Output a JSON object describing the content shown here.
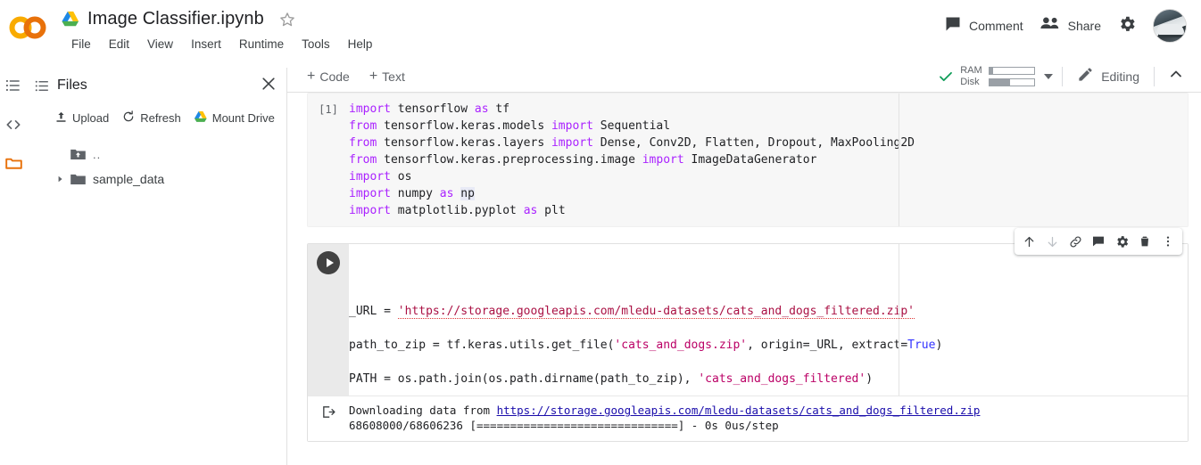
{
  "app": {
    "logo_text": "CO",
    "brand_colors": {
      "logo_outer": "#F9AB00",
      "logo_inner": "#E8710A",
      "accent_folder": "#E8710A"
    }
  },
  "header": {
    "drive_icon": "drive-icon",
    "title": "Image Classifier.ipynb",
    "star_icon": "star-outline-icon",
    "menus": [
      "File",
      "Edit",
      "View",
      "Insert",
      "Runtime",
      "Tools",
      "Help"
    ],
    "comment": {
      "label": "Comment",
      "icon": "comment-icon"
    },
    "share": {
      "label": "Share",
      "icon": "people-icon"
    },
    "settings_icon": "gear-icon",
    "avatar": "user-avatar"
  },
  "toolbar": {
    "add_code_label": "Code",
    "add_text_label": "Text",
    "plus": "+",
    "connected_icon": "green-check-icon",
    "resources": {
      "ram_label": "RAM",
      "disk_label": "Disk",
      "ram_fill_pct": 8,
      "disk_fill_pct": 46
    },
    "dropdown_icon": "chevron-down-icon",
    "editing_label": "Editing",
    "editing_icon": "pencil-icon",
    "collapse_icon": "chevron-up-icon"
  },
  "rail": {
    "items": [
      {
        "name": "table-of-contents",
        "icon": "list-icon"
      },
      {
        "name": "code-snippets",
        "icon": "code-brackets-icon"
      },
      {
        "name": "files",
        "icon": "folder-icon",
        "active": true
      }
    ]
  },
  "files_panel": {
    "menu_icon": "list-icon",
    "title": "Files",
    "close_icon": "close-icon",
    "actions": [
      {
        "label": "Upload",
        "icon": "upload-icon"
      },
      {
        "label": "Refresh",
        "icon": "refresh-icon"
      },
      {
        "label": "Mount Drive",
        "icon": "drive-icon"
      }
    ],
    "tree": [
      {
        "label": "..",
        "icon": "folder-up-icon",
        "expandable": false
      },
      {
        "label": "sample_data",
        "icon": "folder-solid-icon",
        "expandable": true
      }
    ]
  },
  "cells": [
    {
      "type": "code",
      "exec_count": "[1]",
      "selected": false,
      "lines": [
        [
          {
            "t": "import",
            "c": "kw"
          },
          {
            "t": " tensorflow ",
            "c": ""
          },
          {
            "t": "as",
            "c": "kw"
          },
          {
            "t": " tf",
            "c": ""
          }
        ],
        [
          {
            "t": "from",
            "c": "kw"
          },
          {
            "t": " tensorflow.keras.models ",
            "c": ""
          },
          {
            "t": "import",
            "c": "kw"
          },
          {
            "t": " Sequential",
            "c": ""
          }
        ],
        [
          {
            "t": "from",
            "c": "kw"
          },
          {
            "t": " tensorflow.keras.layers ",
            "c": ""
          },
          {
            "t": "import",
            "c": "kw"
          },
          {
            "t": " Dense, Conv2D, Flatten, Dropout, MaxPooling2D",
            "c": ""
          }
        ],
        [
          {
            "t": "from",
            "c": "kw"
          },
          {
            "t": " tensorflow.keras.preprocessing.image ",
            "c": ""
          },
          {
            "t": "import",
            "c": "kw"
          },
          {
            "t": " ImageDataGenerator",
            "c": ""
          }
        ],
        [
          {
            "t": "import",
            "c": "kw"
          },
          {
            "t": " os",
            "c": ""
          }
        ],
        [
          {
            "t": "import",
            "c": "kw"
          },
          {
            "t": " numpy ",
            "c": ""
          },
          {
            "t": "as",
            "c": "kw"
          },
          {
            "t": " ",
            "c": ""
          },
          {
            "t": "np",
            "c": "hl"
          }
        ],
        [
          {
            "t": "import",
            "c": "kw"
          },
          {
            "t": " matplotlib.pyplot ",
            "c": ""
          },
          {
            "t": "as",
            "c": "kw"
          },
          {
            "t": " plt",
            "c": ""
          }
        ]
      ]
    },
    {
      "type": "code",
      "selected": true,
      "run_button": "run-cell-button",
      "lines": [
        [
          {
            "t": "_URL = ",
            "c": ""
          },
          {
            "t": "'https://storage.googleapis.com/mledu-datasets/cats_and_dogs_filtered.zip'",
            "c": "strurl"
          }
        ],
        [
          {
            "t": "",
            "c": ""
          }
        ],
        [
          {
            "t": "path_to_zip = tf.keras.utils.get_file(",
            "c": ""
          },
          {
            "t": "'cats_and_dogs.zip'",
            "c": "str"
          },
          {
            "t": ", origin=_URL, extract=",
            "c": ""
          },
          {
            "t": "True",
            "c": "kw2"
          },
          {
            "t": ")",
            "c": ""
          }
        ],
        [
          {
            "t": "",
            "c": ""
          }
        ],
        [
          {
            "t": "PATH = os.path.join(os.path.dirname(path_to_zip), ",
            "c": ""
          },
          {
            "t": "'cats_and_dogs_filtered'",
            "c": "str"
          },
          {
            "t": ")",
            "c": ""
          }
        ]
      ],
      "output": {
        "icon": "output-arrow-icon",
        "line1_prefix": "Downloading data from ",
        "line1_link": "https://storage.googleapis.com/mledu-datasets/cats_and_dogs_filtered.zip",
        "line2": "68608000/68606236 [==============================] - 0s 0us/step"
      },
      "cell_toolbar": [
        {
          "name": "move-cell-up-button",
          "icon": "arrow-up-icon",
          "enabled": true
        },
        {
          "name": "move-cell-down-button",
          "icon": "arrow-down-icon",
          "enabled": false
        },
        {
          "name": "link-to-cell-button",
          "icon": "link-icon",
          "enabled": true
        },
        {
          "name": "add-comment-button",
          "icon": "comment-icon",
          "enabled": true
        },
        {
          "name": "cell-settings-button",
          "icon": "gear-icon",
          "enabled": true
        },
        {
          "name": "delete-cell-button",
          "icon": "trash-icon",
          "enabled": true
        },
        {
          "name": "more-options-button",
          "icon": "more-vert-icon",
          "enabled": true
        }
      ]
    }
  ]
}
